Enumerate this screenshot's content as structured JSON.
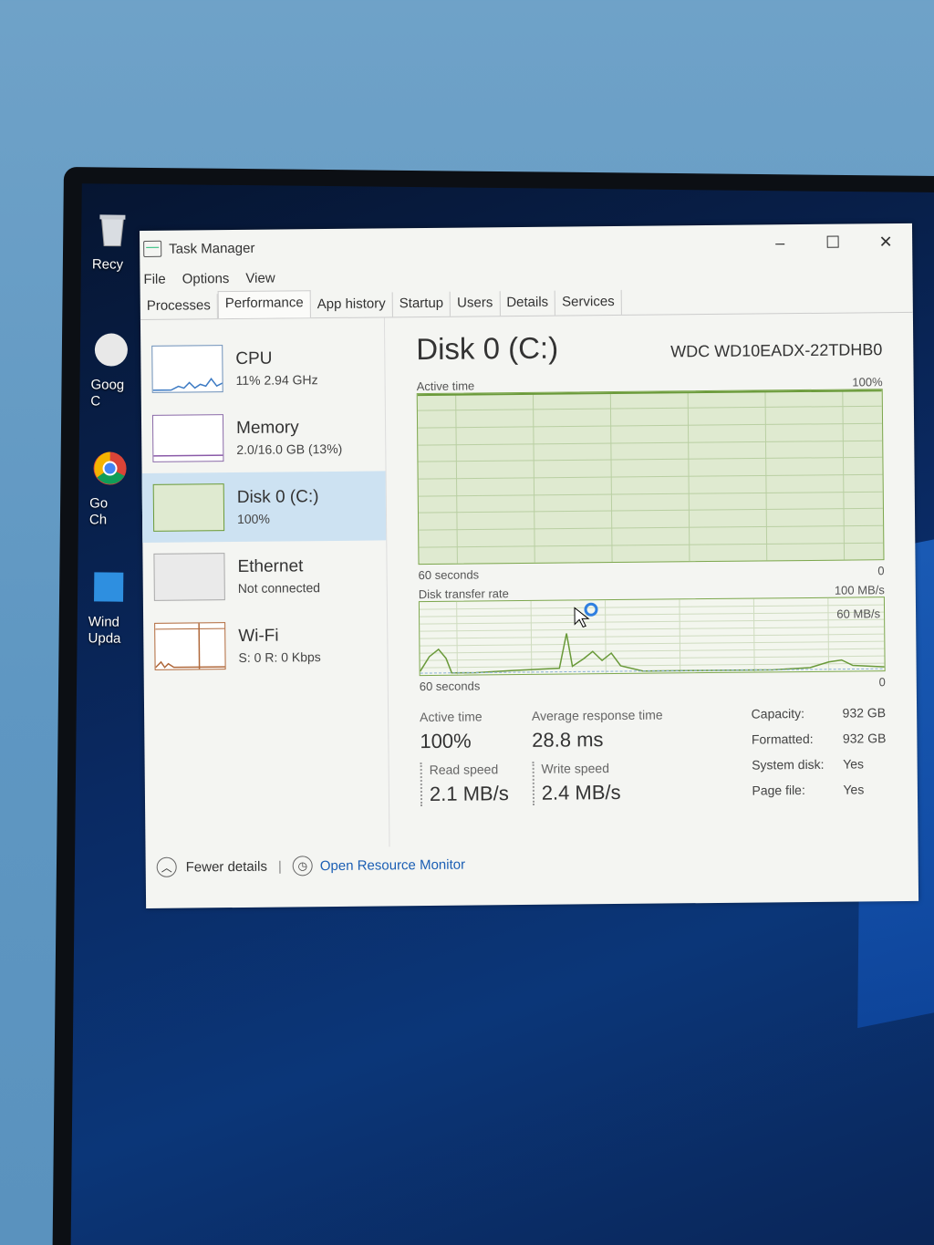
{
  "desktop": {
    "icons": [
      {
        "label_line1": "Recy",
        "label_line2": ""
      },
      {
        "label_line1": "Goog",
        "label_line2": "C"
      },
      {
        "label_line1": "Go",
        "label_line2": "Ch"
      },
      {
        "label_line1": "Wind",
        "label_line2": "Upda"
      }
    ]
  },
  "window": {
    "title": "Task Manager",
    "minimize": "–",
    "maximize": "☐",
    "close": "✕"
  },
  "menu": [
    "File",
    "Options",
    "View"
  ],
  "tabs": [
    "Processes",
    "Performance",
    "App history",
    "Startup",
    "Users",
    "Details",
    "Services"
  ],
  "active_tab": "Performance",
  "sidebar": [
    {
      "name": "CPU",
      "sub": "11% 2.94 GHz"
    },
    {
      "name": "Memory",
      "sub": "2.0/16.0 GB (13%)"
    },
    {
      "name": "Disk 0 (C:)",
      "sub": "100%"
    },
    {
      "name": "Ethernet",
      "sub": "Not connected"
    },
    {
      "name": "Wi-Fi",
      "sub": "S: 0 R: 0 Kbps"
    }
  ],
  "disk": {
    "title": "Disk 0 (C:)",
    "model": "WDC WD10EADX-22TDHB0",
    "active_time_label": "Active time",
    "active_time_max": "100%",
    "graph1_left": "60 seconds",
    "graph1_right": "0",
    "transfer_label": "Disk transfer rate",
    "transfer_max": "100 MB/s",
    "transfer_mark": "60 MB/s",
    "graph2_left": "60 seconds",
    "graph2_right": "0"
  },
  "stats": {
    "active_time_label": "Active time",
    "active_time_value": "100%",
    "avg_response_label": "Average response time",
    "avg_response_value": "28.8 ms",
    "read_label": "Read speed",
    "read_value": "2.1 MB/s",
    "write_label": "Write speed",
    "write_value": "2.4 MB/s"
  },
  "properties": [
    {
      "k": "Capacity:",
      "v": "932 GB"
    },
    {
      "k": "Formatted:",
      "v": "932 GB"
    },
    {
      "k": "System disk:",
      "v": "Yes"
    },
    {
      "k": "Page file:",
      "v": "Yes"
    }
  ],
  "footer": {
    "fewer": "Fewer details",
    "resource_monitor": "Open Resource Monitor"
  },
  "colors": {
    "disk_fill": "#dfead0",
    "disk_line": "#6a9a3a",
    "selected": "#cde2f2",
    "link": "#1c5fb4"
  }
}
